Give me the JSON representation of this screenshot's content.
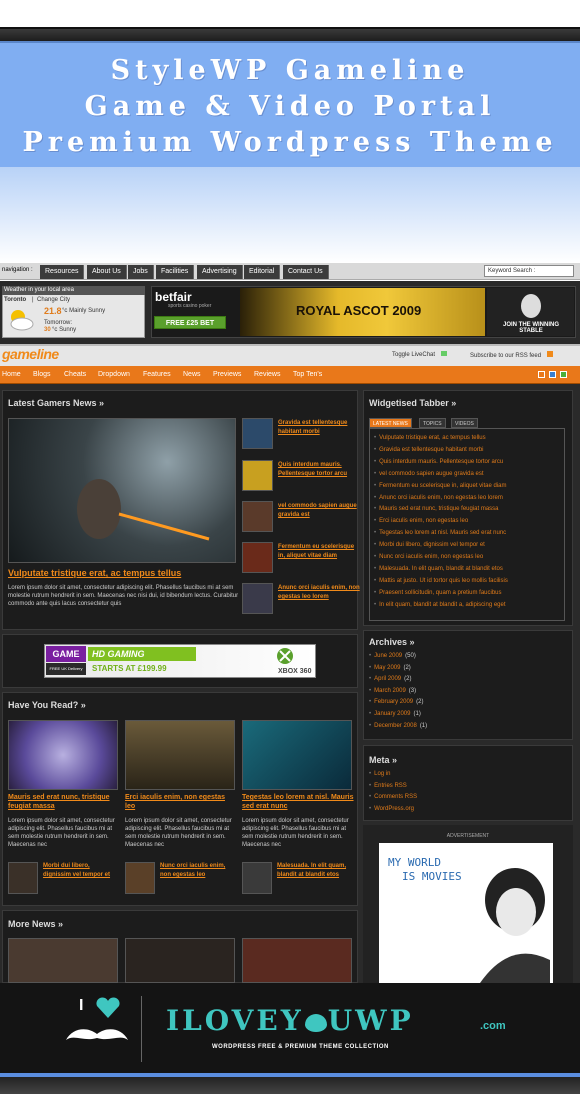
{
  "banner": {
    "line1": "StyleWP Gameline",
    "line2": "Game & Video Portal",
    "line3": "Premium Wordpress Theme"
  },
  "nav": {
    "label": "navigation :",
    "items": [
      "Resources",
      "About Us",
      "Jobs",
      "Facilities",
      "Advertising",
      "Editorial",
      "Contact Us"
    ],
    "search_placeholder": "Keyword Search :"
  },
  "weather": {
    "header": "Weather in your local area",
    "city": "Toronto",
    "change": "Change City",
    "today_temp": "21.8",
    "today_unit": "°c Mainly Sunny",
    "tomorrow_label": "Tomorrow:",
    "tomorrow_temp": "30",
    "tomorrow_unit": "°c Sunny"
  },
  "ad_betfair": {
    "logo": "betfair",
    "sub": "sports casino poker",
    "button": "FREE £25 BET",
    "headline": "ROYAL ASCOT 2009",
    "stable": "JOIN THE WINNING STABLE"
  },
  "site": {
    "logo": "gameline",
    "livechat": "Toggle LiveChat",
    "rss": "Subscribe to our RSS feed"
  },
  "menu": [
    "Home",
    "Blogs",
    "Cheats",
    "Dropdown",
    "Features",
    "News",
    "Previews",
    "Reviews",
    "Top Ten's"
  ],
  "latest": {
    "title": "Latest Gamers News »",
    "headline": "Vulputate tristique erat, ac tempus tellus",
    "body": "Lorem ipsum dolor sit amet, consectetur adipiscing elit. Phasellus faucibus mi at sem molestie rutrum hendrerit in sem. Maecenas nec nisi dui, id bibendum lectus. Curabitur commodo ante quis lacus consectetur quis",
    "side": [
      "Gravida est tellentesque habitant morbi",
      "Quis interdum mauris. Pellentesque tortor arcu",
      "vel commodo sapien augue gravida est",
      "Fermentum eu scelerisque in, aliquet vitae diam",
      "Anunc orci iaculis enim, non egestas leo lorem"
    ]
  },
  "ad_game": {
    "brand": "GAME",
    "text": "HD GAMING",
    "price": "STARTS AT £199.99",
    "console": "XBOX 360",
    "delivery": "FREE UK Delivery"
  },
  "haveyouread": {
    "title": "Have You Read? »",
    "cols": [
      {
        "title": "Mauris sed erat nunc, tristique feugiat massa",
        "body": "Lorem ipsum dolor sit amet, consectetur adipiscing elit. Phasellus faucibus mi at sem molestie rutrum hendrerit in sem. Maecenas nec",
        "sub": "Morbi dui libero, dignissim vel tempor et"
      },
      {
        "title": "Erci iaculis enim, non egestas leo",
        "body": "Lorem ipsum dolor sit amet, consectetur adipiscing elit. Phasellus faucibus mi at sem molestie rutrum hendrerit in sem. Maecenas nec",
        "sub": "Nunc orci iaculis enim, non egestas leo"
      },
      {
        "title": "Tegestas leo lorem at nisl. Mauris sed erat nunc",
        "body": "Lorem ipsum dolor sit amet, consectetur adipiscing elit. Phasellus faucibus mi at sem molestie rutrum hendrerit in sem. Maecenas nec",
        "sub": "Malesuada. In elit quam, blandit at blandit etos"
      }
    ]
  },
  "morenews": {
    "title": "More News »"
  },
  "tabber": {
    "title": "Widgetised Tabber »",
    "tabs": [
      "LATEST NEWS",
      "TOPICS",
      "VIDEOS"
    ],
    "items": [
      "Vulputate tristique erat, ac tempus tellus",
      "Gravida est tellentesque habitant morbi",
      "Quis interdum mauris. Pellentesque tortor arcu",
      "vel commodo sapien augue gravida est",
      "Fermentum eu scelerisque in, aliquet vitae diam",
      "Anunc orci iaculis enim, non egestas leo lorem",
      "Mauris sed erat nunc, tristique feugiat massa",
      "Erci iaculis enim, non egestas leo",
      "Tegestas leo lorem at nisl. Mauris sed erat nunc",
      "Morbi dui libero, dignissim vel tempor et",
      "Nunc orci iaculis enim, non egestas leo",
      "Malesuada. In elit quam, blandit at blandit etos",
      "Mattis at justo. Ut id tortor quis leo mollis facilisis",
      "Praesent sollicitudin, quam a pretium faucibus",
      "In elit quam, blandit at blandit a, adipiscing eget"
    ]
  },
  "archives": {
    "title": "Archives »",
    "items": [
      {
        "month": "June 2009",
        "count": "(50)"
      },
      {
        "month": "May 2009",
        "count": "(2)"
      },
      {
        "month": "April 2009",
        "count": "(2)"
      },
      {
        "month": "March 2009",
        "count": "(3)"
      },
      {
        "month": "February 2009",
        "count": "(2)"
      },
      {
        "month": "January 2009",
        "count": "(1)"
      },
      {
        "month": "December 2008",
        "count": "(1)"
      }
    ]
  },
  "meta": {
    "title": "Meta »",
    "items": [
      "Log in",
      "Entries RSS",
      "Comments RSS",
      "WordPress.org"
    ]
  },
  "advert": {
    "label": "ADVERTISEMENT",
    "text_line1": "MY WORLD",
    "text_line2": "IS MOVIES"
  },
  "footer": {
    "i": "I",
    "brand_left": "ILOVEY",
    "brand_right": "UWP",
    "dotcom": ".com",
    "tagline": "WORDPRESS FREE & PREMIUM THEME COLLECTION"
  },
  "colors": {
    "accent": "#f08a1a",
    "banner": "#80aef2",
    "teal": "#3fc6c0"
  }
}
